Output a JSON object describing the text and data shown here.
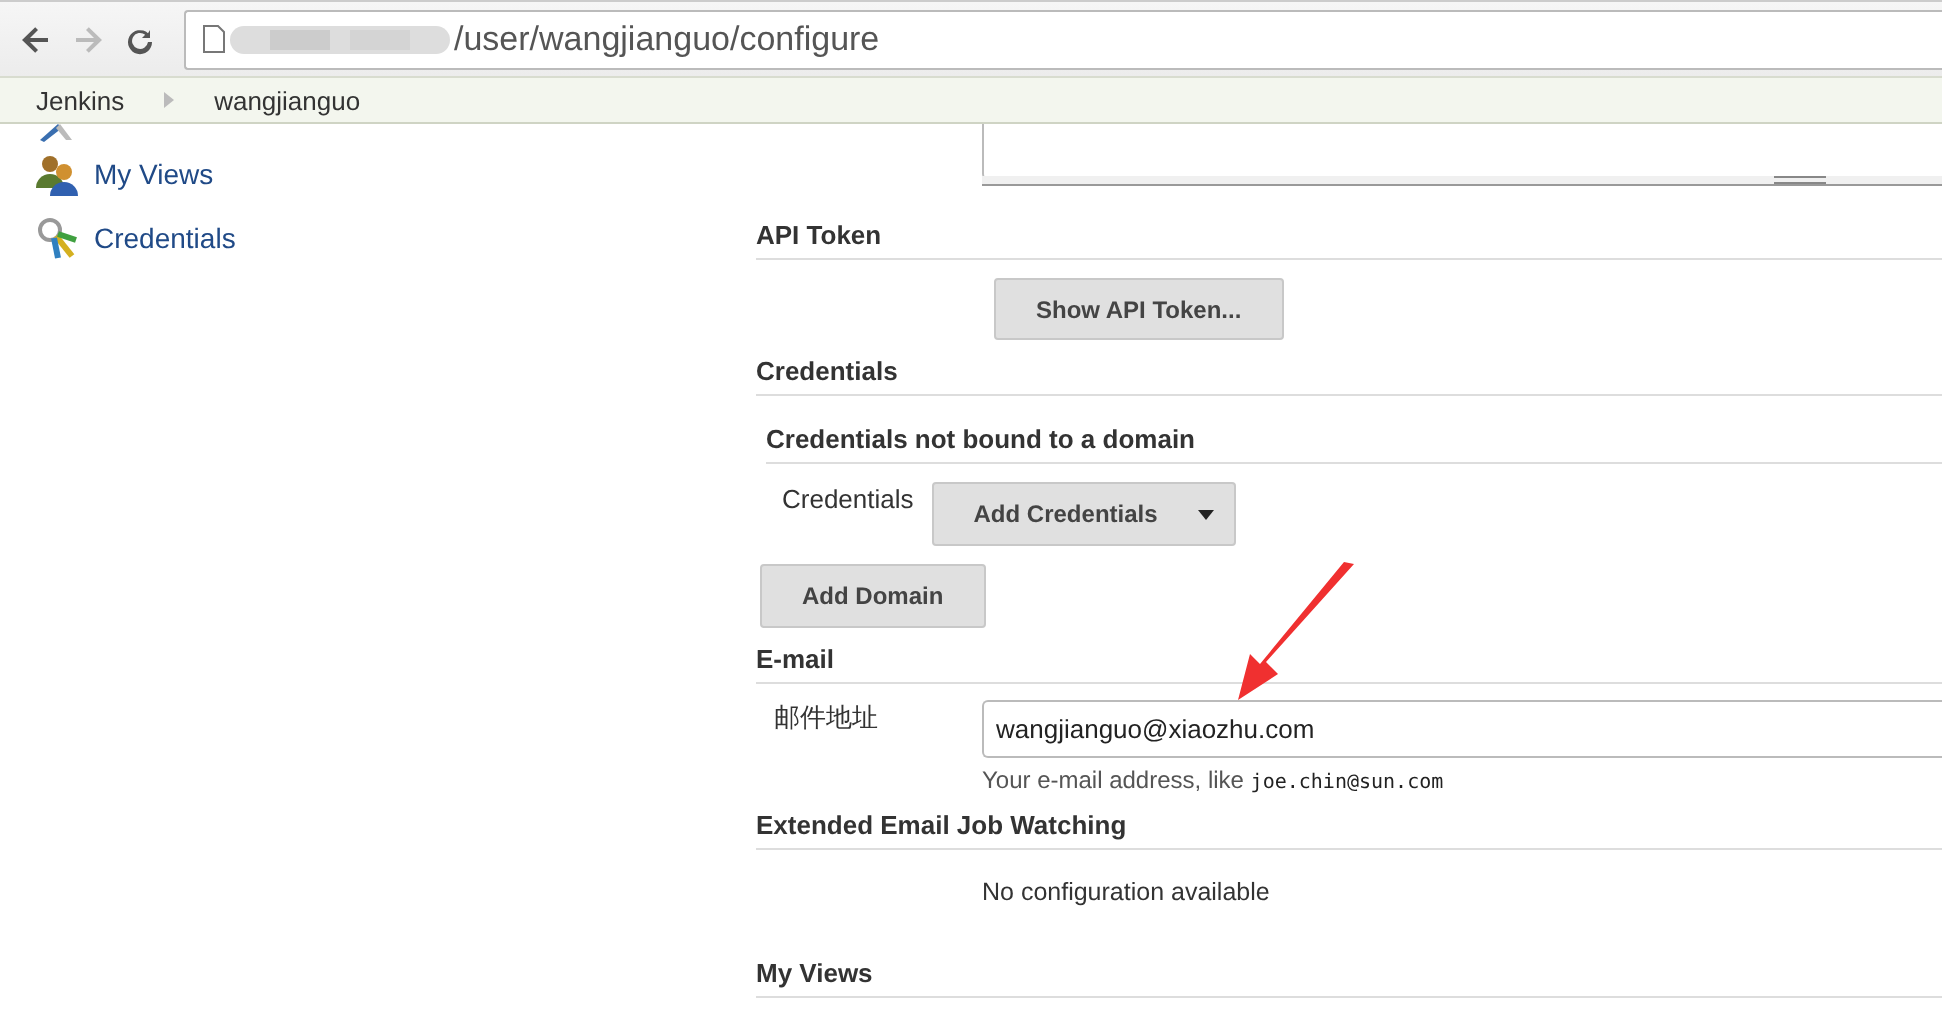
{
  "browser": {
    "url": "/user/wangjianguo/configure"
  },
  "breadcrumbs": [
    "Jenkins",
    "wangjianguo"
  ],
  "sidebar": {
    "items": [
      {
        "label": "My Views",
        "kind": "views"
      },
      {
        "label": "Credentials",
        "kind": "keys"
      }
    ]
  },
  "sections": [
    {
      "kind": "button",
      "title": "API Token",
      "button": "Show API Token..."
    },
    {
      "kind": "credentials",
      "title": "Credentials",
      "subtitle": "Credentials not bound to a domain",
      "label": "Credentials",
      "dropdown": "Add Credentials",
      "button": "Add Domain"
    },
    {
      "kind": "field",
      "title": "E-mail",
      "label": "邮件地址",
      "value": "wangjianguo@xiaozhu.com",
      "help": "Your e-mail address, like",
      "example": "joe.chin@sun.com"
    },
    {
      "kind": "note",
      "title": "Extended Email Job Watching",
      "note": "No configuration available"
    },
    {
      "kind": "header",
      "title": "My Views"
    }
  ]
}
